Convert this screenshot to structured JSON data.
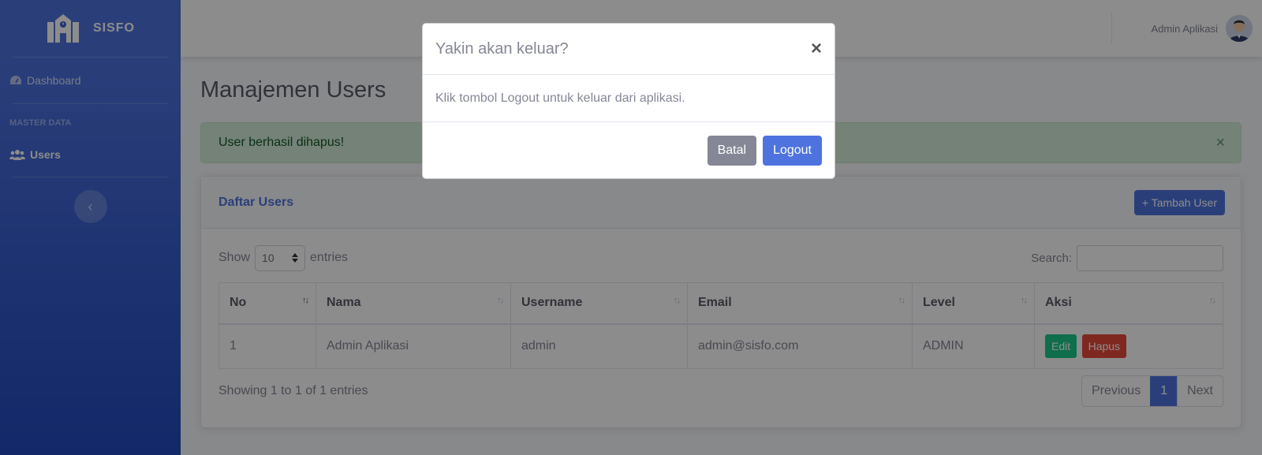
{
  "brand": {
    "name": "SISFO",
    "icon": "school-building-icon"
  },
  "sidebar": {
    "dashboard_label": "Dashboard",
    "heading": "MASTER DATA",
    "users_label": "Users",
    "toggle_icon": "chevron-left-icon"
  },
  "topbar": {
    "user_name": "Admin Aplikasi"
  },
  "page": {
    "title": "Manajemen Users"
  },
  "alert": {
    "message": "User berhasil dihapus!",
    "close": "×"
  },
  "card": {
    "title": "Daftar Users",
    "add_button": "+ Tambah User",
    "show_label": "Show",
    "entries_value": "10",
    "entries_label": "entries",
    "search_label": "Search:",
    "search_value": "",
    "columns": [
      "No",
      "Nama",
      "Username",
      "Email",
      "Level",
      "Aksi"
    ],
    "rows": [
      {
        "no": "1",
        "nama": "Admin Aplikasi",
        "username": "admin",
        "email": "admin@sisfo.com",
        "level": "ADMIN",
        "edit": "Edit",
        "delete": "Hapus"
      }
    ],
    "info": "Showing 1 to 1 of 1 entries",
    "pagination": {
      "previous": "Previous",
      "current": "1",
      "next": "Next"
    }
  },
  "modal": {
    "title": "Yakin akan keluar?",
    "close": "×",
    "body": "Klik tombol Logout untuk keluar dari aplikasi.",
    "cancel": "Batal",
    "logout": "Logout"
  },
  "colors": {
    "primary": "#4e73df",
    "success": "#1cc88a",
    "danger": "#e74a3b",
    "secondary": "#858796"
  }
}
